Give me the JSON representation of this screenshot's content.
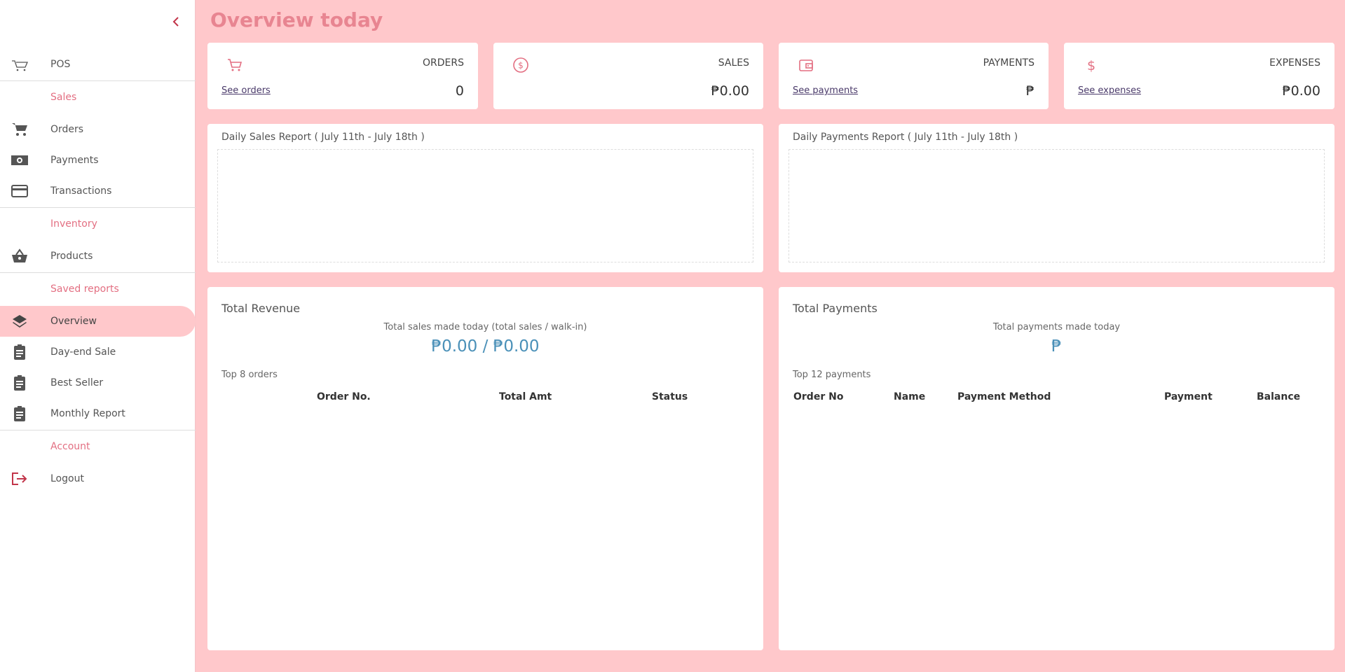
{
  "sidebar": {
    "items": {
      "pos": "POS",
      "orders": "Orders",
      "payments": "Payments",
      "transactions": "Transactions",
      "products": "Products",
      "overview": "Overview",
      "dayend": "Day-end Sale",
      "bestseller": "Best Seller",
      "monthly": "Monthly Report",
      "logout": "Logout"
    },
    "sections": {
      "sales": "Sales",
      "inventory": "Inventory",
      "saved_reports": "Saved reports",
      "account": "Account"
    },
    "active_item": "overview"
  },
  "page": {
    "title": "Overview today"
  },
  "stats": {
    "orders": {
      "caption": "ORDERS",
      "link": "See orders",
      "value": "0",
      "icon": "cart-icon"
    },
    "sales": {
      "caption": "SALES",
      "value": "₱0.00",
      "icon": "dollar-circle-icon"
    },
    "payments": {
      "caption": "PAYMENTS",
      "link": "See payments",
      "value": "₱",
      "icon": "wallet-icon"
    },
    "expenses": {
      "caption": "EXPENSES",
      "link": "See expenses",
      "value": "₱0.00",
      "icon": "dollar-icon"
    }
  },
  "reports": {
    "daily_sales": "Daily Sales Report ( July 11th - July 18th )",
    "daily_payments": "Daily Payments Report ( July 11th - July 18th )"
  },
  "revenue": {
    "title": "Total Revenue",
    "subtitle": "Total sales made today (total sales / walk-in)",
    "amount": "₱0.00 / ₱0.00",
    "top_label": "Top 8 orders",
    "columns": [
      "Order No.",
      "Total Amt",
      "Status"
    ]
  },
  "payments_panel": {
    "title": "Total Payments",
    "subtitle": "Total payments made today",
    "amount": "₱",
    "top_label": "Top 12 payments",
    "columns": [
      "Order No",
      "Name",
      "Payment Method",
      "Payment",
      "Balance"
    ]
  },
  "colors": {
    "accent": "#e36f82",
    "background": "#ffc8cb",
    "amount": "#4a90b8"
  }
}
